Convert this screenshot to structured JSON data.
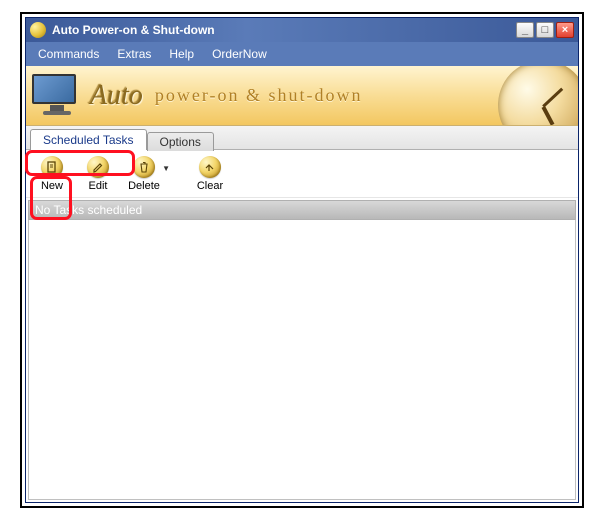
{
  "window": {
    "title": "Auto Power-on & Shut-down"
  },
  "menu": {
    "commands": "Commands",
    "extras": "Extras",
    "help": "Help",
    "ordernow": "OrderNow"
  },
  "banner": {
    "brand": "Auto",
    "tagline": "power-on & shut-down"
  },
  "tabs": {
    "scheduled": "Scheduled Tasks",
    "options": "Options"
  },
  "toolbar": {
    "new_label": "New",
    "edit_label": "Edit",
    "delete_label": "Delete",
    "clear_label": "Clear"
  },
  "list": {
    "empty_message": "No Tasks scheduled"
  }
}
